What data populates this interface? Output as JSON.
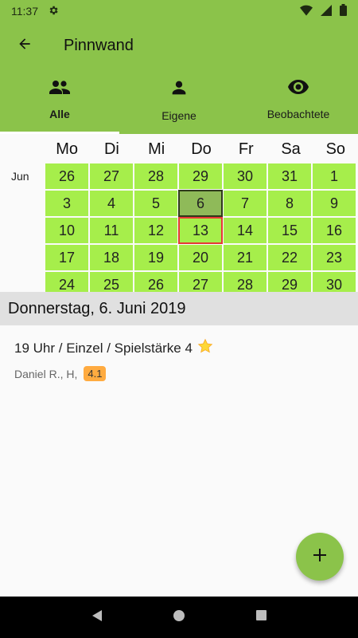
{
  "status_bar": {
    "time": "11:37",
    "icons": [
      "settings-icon",
      "wifi-icon",
      "signal-icon",
      "battery-icon"
    ]
  },
  "app_bar": {
    "title": "Pinnwand",
    "back_icon": "arrow-back-icon",
    "color": "#8bc34a"
  },
  "tabs": [
    {
      "label": "Alle",
      "icon": "group-icon",
      "active": true
    },
    {
      "label": "Eigene",
      "icon": "person-icon",
      "active": false
    },
    {
      "label": "Beobachtete",
      "icon": "eye-icon",
      "active": false
    }
  ],
  "calendar": {
    "weekdays": [
      "Mo",
      "Di",
      "Mi",
      "Do",
      "Fr",
      "Sa",
      "So"
    ],
    "month_label": "Jun",
    "days": [
      "26",
      "27",
      "28",
      "29",
      "30",
      "31",
      "1",
      "3",
      "4",
      "5",
      "6",
      "7",
      "8",
      "9",
      "10",
      "11",
      "12",
      "13",
      "14",
      "15",
      "16",
      "17",
      "18",
      "19",
      "20",
      "21",
      "22",
      "23",
      "24",
      "25",
      "26",
      "27",
      "28",
      "29",
      "30"
    ],
    "selected_day": "6",
    "today_day": "13",
    "day_color": "#a6ee4b"
  },
  "date_header": "Donnerstag, 6. Juni 2019",
  "entries": [
    {
      "title": "19 Uhr / Einzel / Spielstärke 4",
      "icon": "star-icon",
      "players": "Daniel R., H,",
      "rating": "4.1"
    }
  ],
  "fab": {
    "icon": "plus-icon"
  },
  "nav_bar": {
    "buttons": [
      "back-triangle-icon",
      "home-circle-icon",
      "recents-square-icon"
    ]
  }
}
